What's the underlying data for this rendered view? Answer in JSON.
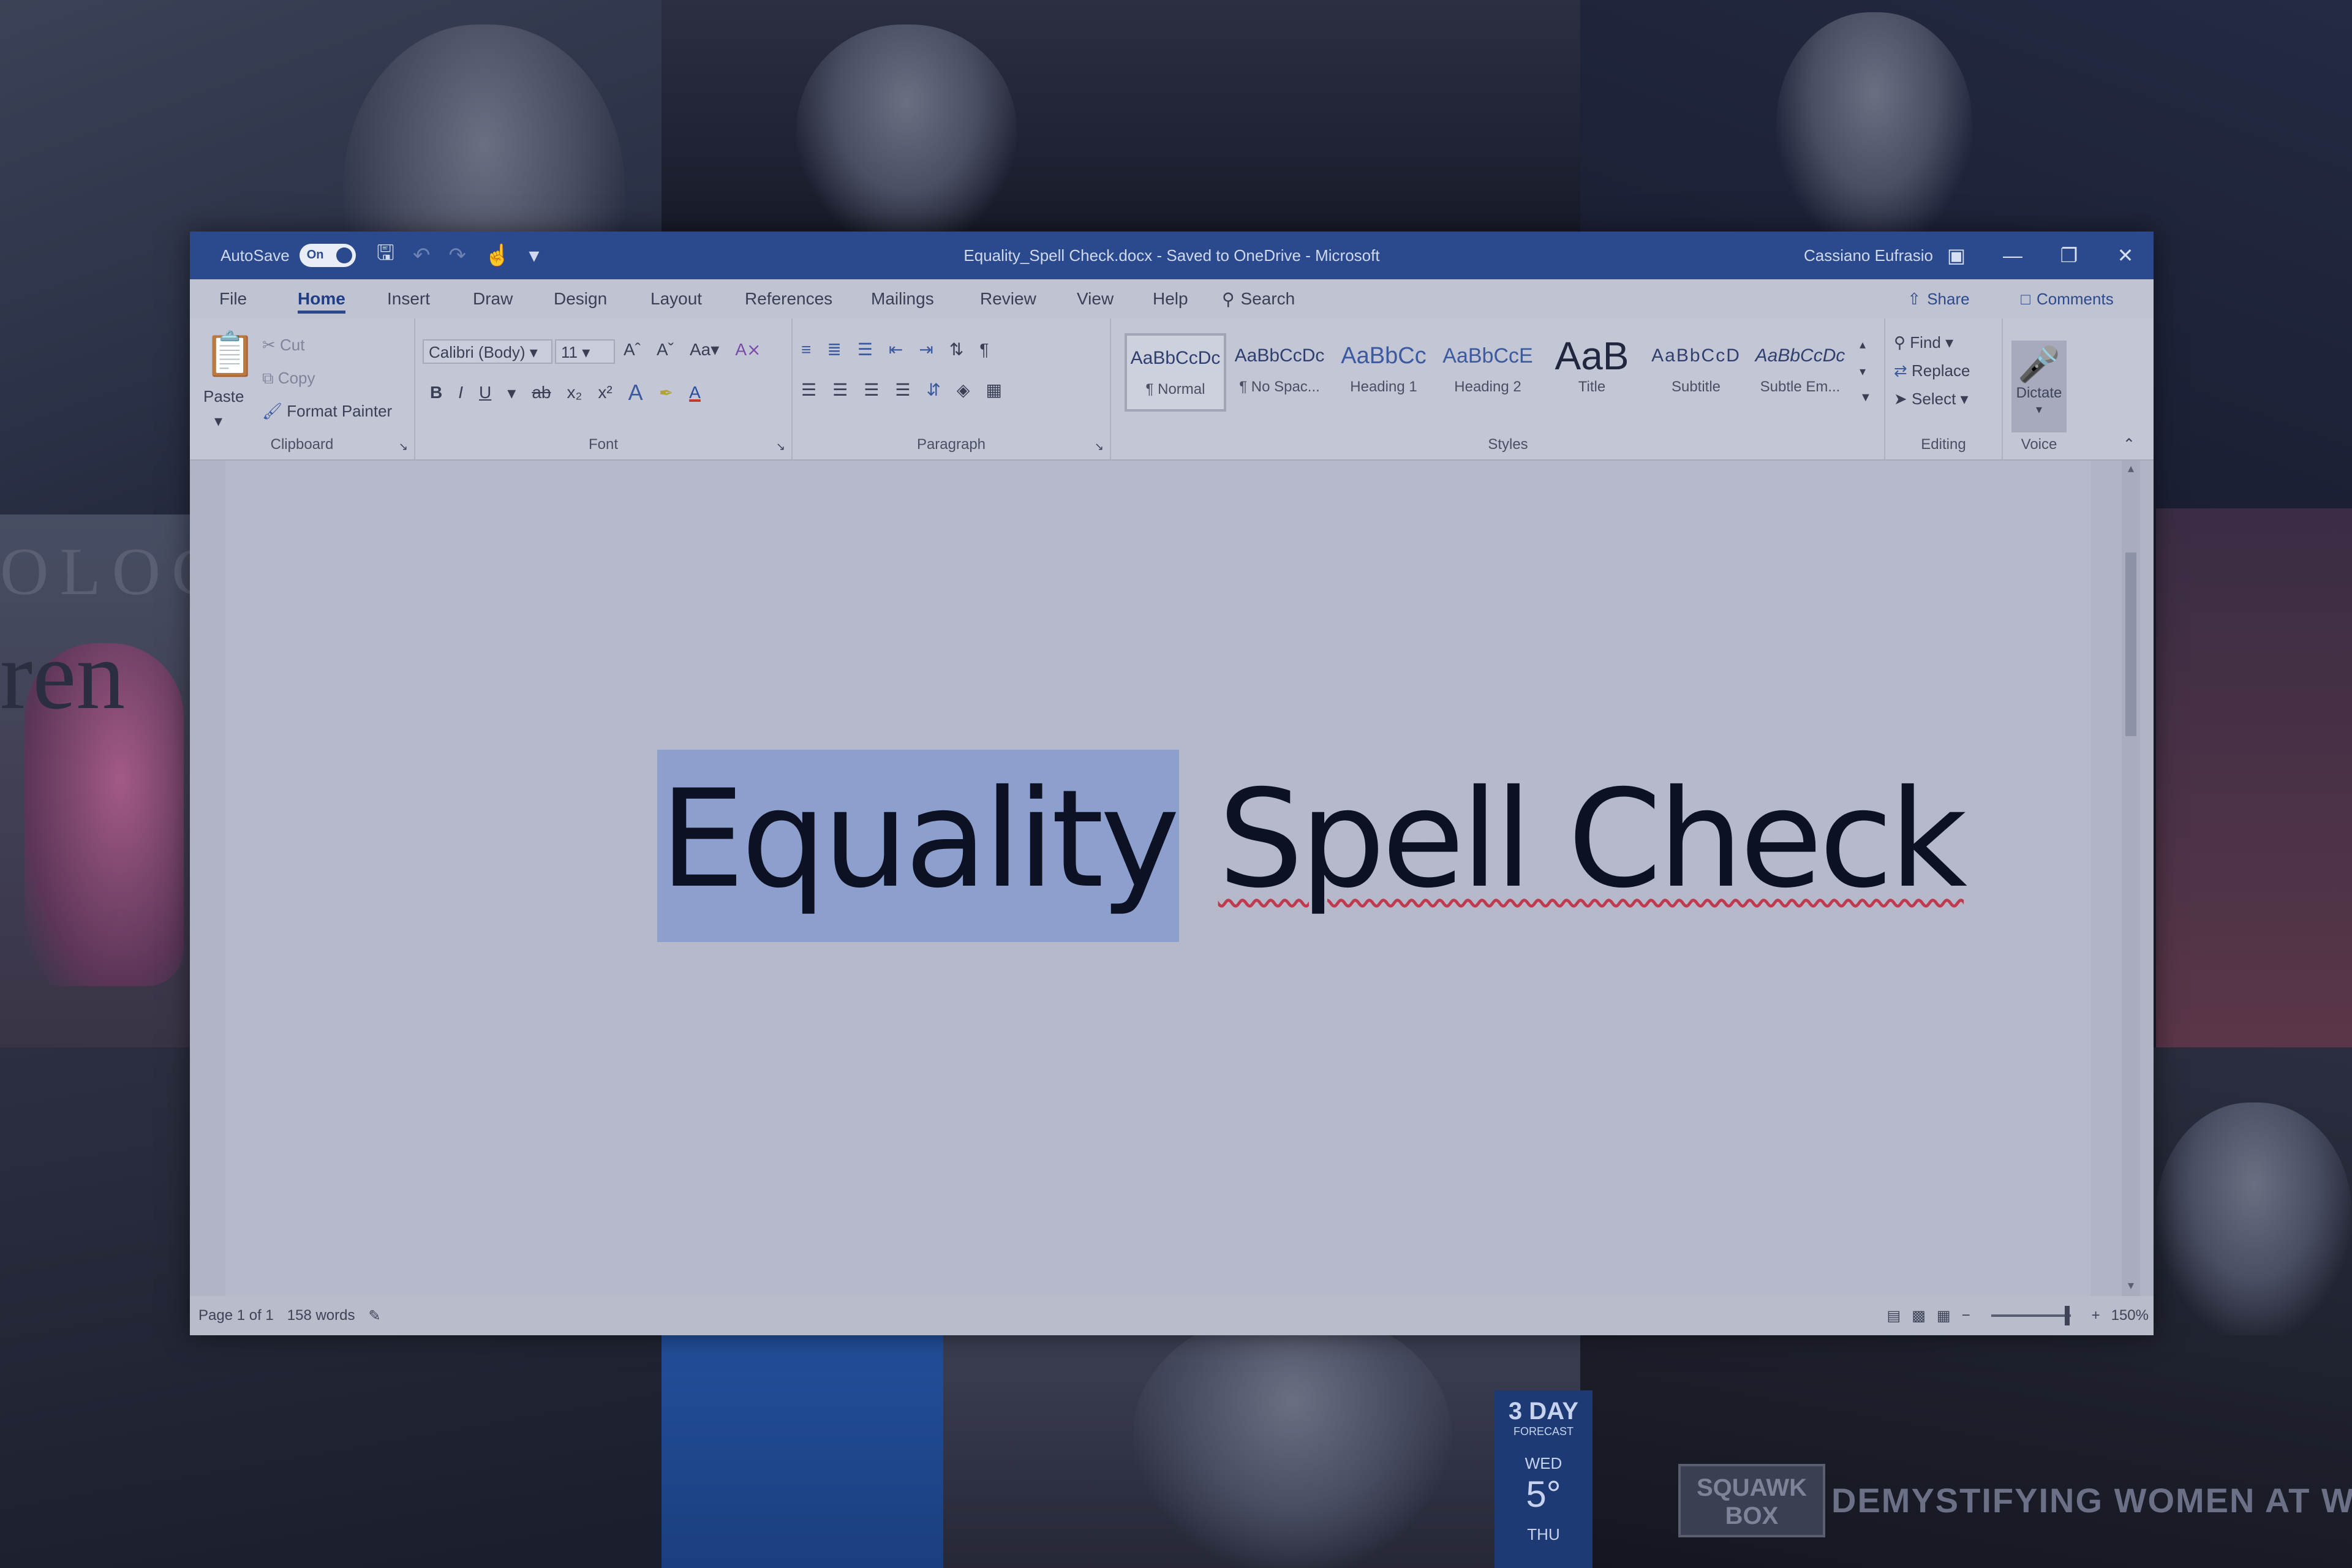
{
  "titlebar": {
    "autosave_label": "AutoSave",
    "autosave_state": "On",
    "doc_title": "Equality_Spell Check.docx - Saved to OneDrive - Microsoft",
    "user_name": "Cassiano Eufrasio"
  },
  "tabs": [
    "File",
    "Home",
    "Insert",
    "Draw",
    "Design",
    "Layout",
    "References",
    "Mailings",
    "Review",
    "View",
    "Help"
  ],
  "active_tab": "Home",
  "search_label": "Search",
  "share_label": "Share",
  "comments_label": "Comments",
  "clipboard": {
    "paste": "Paste",
    "cut": "Cut",
    "copy": "Copy",
    "format_painter": "Format Painter",
    "group": "Clipboard"
  },
  "font": {
    "family": "Calibri (Body)",
    "size": "11",
    "group": "Font"
  },
  "paragraph": {
    "group": "Paragraph"
  },
  "styles": {
    "group": "Styles",
    "items": [
      {
        "preview": "AaBbCcDc",
        "name": "¶ Normal"
      },
      {
        "preview": "AaBbCcDc",
        "name": "¶ No Spac..."
      },
      {
        "preview": "AaBbCc",
        "name": "Heading 1"
      },
      {
        "preview": "AaBbCcE",
        "name": "Heading 2"
      },
      {
        "preview": "AaB",
        "name": "Title"
      },
      {
        "preview": "AaBbCcD",
        "name": "Subtitle"
      },
      {
        "preview": "AaBbCcDc",
        "name": "Subtle Em..."
      }
    ]
  },
  "editing": {
    "find": "Find",
    "replace": "Replace",
    "select": "Select",
    "group": "Editing"
  },
  "voice": {
    "dictate": "Dictate",
    "group": "Voice"
  },
  "document": {
    "word_selected": "Equality",
    "word_misspelled": "Spell Check"
  },
  "statusbar": {
    "page": "Page 1 of 1",
    "words": "158 words",
    "zoom": "150%"
  },
  "background": {
    "ology": "OLOGY",
    "ren": "ren",
    "forecast_title": "3 DAY",
    "forecast_sub": "FORECAST",
    "forecast_day": "WED",
    "forecast_temp": "5°",
    "forecast_day2": "THU",
    "squawk": "SQUAWK BOX",
    "banner": "DEMYSTIFYING WOMEN AT WOR"
  },
  "colors": {
    "titlebar": "#2b4a8e",
    "selection": "#8c9fcd",
    "spell_underline": "#c03a4f"
  }
}
